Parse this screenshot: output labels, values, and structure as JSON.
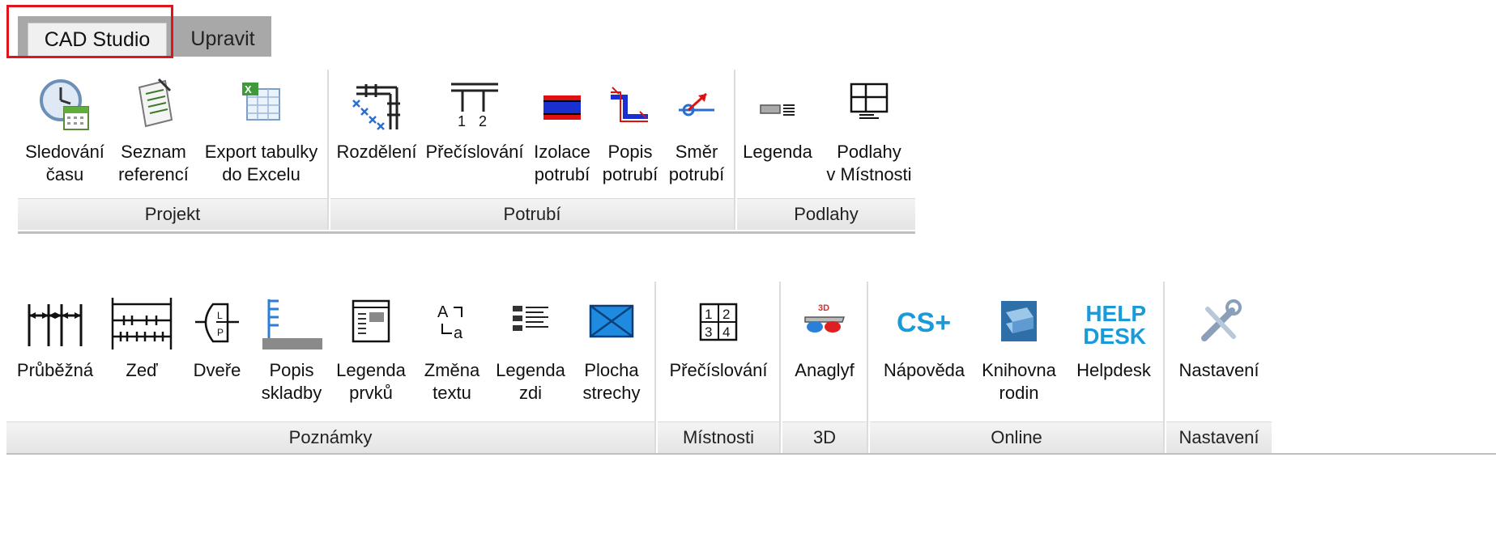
{
  "tabs": [
    {
      "label": "CAD Studio",
      "active": true
    },
    {
      "label": "Upravit",
      "active": false
    }
  ],
  "ribbon1": {
    "projekt": {
      "title": "Projekt",
      "buttons": [
        {
          "label": "Sledování\nčasu",
          "icon": "clock-calendar-icon"
        },
        {
          "label": "Seznam\nreferencí",
          "icon": "document-list-icon"
        },
        {
          "label": "Export tabulky\ndo Excelu",
          "icon": "excel-table-icon"
        }
      ]
    },
    "potrubi": {
      "title": "Potrubí",
      "buttons": [
        {
          "label": "Rozdělení",
          "icon": "split-pipe-icon"
        },
        {
          "label": "Přečíslování",
          "icon": "renumber-pipe-icon"
        },
        {
          "label": "Izolace\npotrubí",
          "icon": "pipe-insulation-icon"
        },
        {
          "label": "Popis\npotrubí",
          "icon": "pipe-label-icon"
        },
        {
          "label": "Směr\npotrubí",
          "icon": "pipe-direction-icon"
        }
      ]
    },
    "podlahy": {
      "title": "Podlahy",
      "buttons": [
        {
          "label": "Legenda",
          "icon": "legend-icon"
        },
        {
          "label": "Podlahy\nv Místnosti",
          "icon": "room-floors-icon"
        }
      ]
    }
  },
  "ribbon2": {
    "poznamky": {
      "title": "Poznámky",
      "buttons": [
        {
          "label": "Průběžná",
          "icon": "running-dimension-icon"
        },
        {
          "label": "Zeď",
          "icon": "wall-dimension-icon"
        },
        {
          "label": "Dveře",
          "icon": "door-tag-icon"
        },
        {
          "label": "Popis\nskladby",
          "icon": "layer-description-icon"
        },
        {
          "label": "Legenda\nprvků",
          "icon": "element-legend-icon"
        },
        {
          "label": "Změna\ntextu",
          "icon": "change-text-icon"
        },
        {
          "label": "Legenda\nzdi",
          "icon": "wall-legend-icon"
        },
        {
          "label": "Plocha\nstrechy",
          "icon": "roof-area-icon"
        }
      ]
    },
    "mistnosti": {
      "title": "Místnosti",
      "buttons": [
        {
          "label": "Přečíslování",
          "icon": "renumber-rooms-icon"
        }
      ]
    },
    "three_d": {
      "title": "3D",
      "buttons": [
        {
          "label": "Anaglyf",
          "icon": "anaglyph-glasses-icon"
        }
      ]
    },
    "online": {
      "title": "Online",
      "buttons": [
        {
          "label": "Nápověda",
          "icon": "cs-plus-icon",
          "text": "CS+"
        },
        {
          "label": "Knihovna\nrodin",
          "icon": "family-library-icon"
        },
        {
          "label": "Helpdesk",
          "icon": "helpdesk-icon",
          "text": "HELP\nDESK"
        }
      ]
    },
    "nastaveni": {
      "title": "Nastavení",
      "buttons": [
        {
          "label": "Nastavení",
          "icon": "settings-tools-icon"
        }
      ]
    }
  },
  "colors": {
    "highlight": "#e0141c",
    "tabbar": "#a8a8a8",
    "accent_blue": "#1e64b4",
    "pipe_red": "#e01010"
  }
}
